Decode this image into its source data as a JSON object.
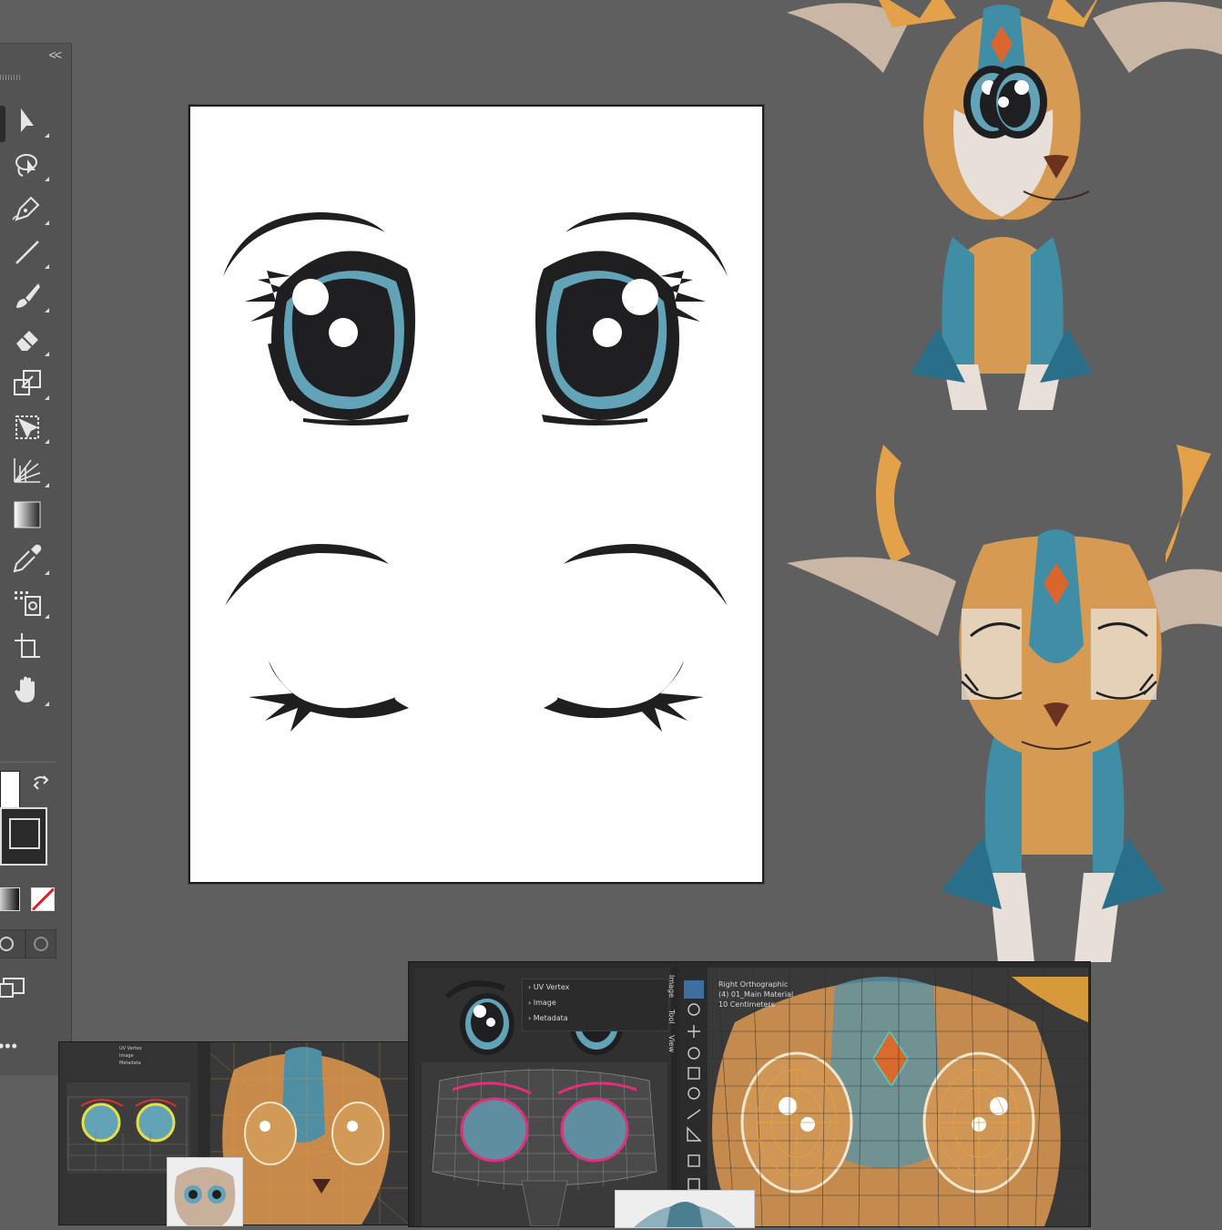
{
  "toolbar": {
    "collapse_label": "<<",
    "tools": [
      {
        "name": "selection-tool",
        "icon": "arrow-icon"
      },
      {
        "name": "lasso-tool",
        "icon": "lasso-icon"
      },
      {
        "name": "pen-tool",
        "icon": "pen-icon"
      },
      {
        "name": "line-tool",
        "icon": "line-icon"
      },
      {
        "name": "brush-tool",
        "icon": "brush-icon"
      },
      {
        "name": "eraser-tool",
        "icon": "eraser-icon"
      },
      {
        "name": "scale-tool",
        "icon": "scale-icon"
      },
      {
        "name": "free-transform-tool",
        "icon": "free-transform-icon"
      },
      {
        "name": "perspective-grid-tool",
        "icon": "perspective-grid-icon"
      },
      {
        "name": "gradient-tool",
        "icon": "gradient-icon"
      },
      {
        "name": "eyedropper-tool",
        "icon": "eyedropper-icon"
      },
      {
        "name": "symbol-sprayer-tool",
        "icon": "symbol-sprayer-icon"
      },
      {
        "name": "artboard-tool",
        "icon": "artboard-icon"
      },
      {
        "name": "hand-tool",
        "icon": "hand-icon"
      }
    ],
    "more_label": "•••"
  },
  "colors": {
    "eye_blue": "#62a3b8",
    "ink": "#1f1f21",
    "pupil": "#1f1f21",
    "highlight": "#ffffff",
    "fur_orange": "#d69a52",
    "fur_teal": "#3f8ea6",
    "fur_cream": "#e8e0d8",
    "artboard_bg": "#ffffff",
    "canvas_bg": "#5f5f5f",
    "wire_orange": "#f0a030",
    "uv_pink": "#e0307a",
    "uv_yellow": "#e6e040"
  },
  "blender_main": {
    "panels": [
      "UV Vertex",
      "Image",
      "Metadata"
    ],
    "side_tabs": [
      "Image",
      "Tool",
      "View"
    ],
    "viewport_title": "Right Orthographic",
    "viewport_object": "(4) 01_Main Material",
    "viewport_units": "10 Centimeters"
  },
  "blender_small": {
    "panels": [
      "UV Vertex",
      "Image",
      "Metadata"
    ]
  }
}
